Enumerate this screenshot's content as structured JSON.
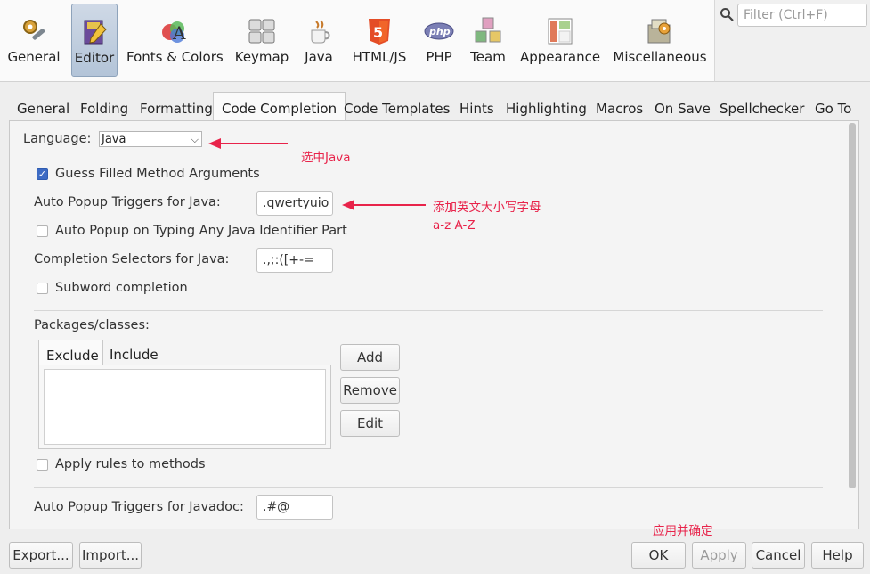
{
  "toolbar": {
    "categories": [
      {
        "label": "General",
        "icon": "gear-wrench-icon"
      },
      {
        "label": "Editor",
        "icon": "editor-book-icon"
      },
      {
        "label": "Fonts & Colors",
        "icon": "fonts-colors-icon"
      },
      {
        "label": "Keymap",
        "icon": "keyboard-icon"
      },
      {
        "label": "Java",
        "icon": "java-cup-icon"
      },
      {
        "label": "HTML/JS",
        "icon": "html5-icon"
      },
      {
        "label": "PHP",
        "icon": "php-icon"
      },
      {
        "label": "Team",
        "icon": "team-cubes-icon"
      },
      {
        "label": "Appearance",
        "icon": "appearance-window-icon"
      },
      {
        "label": "Miscellaneous",
        "icon": "misc-folder-gear-icon"
      }
    ],
    "selected": "Editor",
    "filter_placeholder": "Filter (Ctrl+F)"
  },
  "tabs": [
    "General",
    "Folding",
    "Formatting",
    "Code Completion",
    "Code Templates",
    "Hints",
    "Highlighting",
    "Macros",
    "On Save",
    "Spellchecker",
    "Go To"
  ],
  "active_tab": "Code Completion",
  "form": {
    "language_label": "Language:",
    "language_value": "Java",
    "guess_filled": {
      "label": "Guess Filled Method Arguments",
      "checked": true
    },
    "auto_popup_triggers_label": "Auto Popup Triggers for Java:",
    "auto_popup_triggers_value": ".qwertyuio",
    "auto_popup_typing": {
      "label": "Auto Popup on Typing Any Java Identifier Part",
      "checked": false
    },
    "completion_selectors_label": "Completion Selectors for Java:",
    "completion_selectors_value": ".,;:([+-=",
    "subword": {
      "label": "Subword completion",
      "checked": false
    },
    "packages_label": "Packages/classes:",
    "subtabs": [
      "Exclude",
      "Include"
    ],
    "buttons": {
      "add": "Add",
      "remove": "Remove",
      "edit": "Edit"
    },
    "apply_rules": {
      "label": "Apply rules to methods",
      "checked": false
    },
    "javadoc_triggers_label": "Auto Popup Triggers for Javadoc:",
    "javadoc_triggers_value": ".#@"
  },
  "annotations": {
    "select_java": "选中Java",
    "add_letters_1": "添加英文大小写字母",
    "add_letters_2": "a-z A-Z",
    "apply_confirm": "应用并确定"
  },
  "footer": {
    "export": "Export...",
    "import": "Import...",
    "ok": "OK",
    "apply": "Apply",
    "cancel": "Cancel",
    "help": "Help"
  },
  "colors": {
    "annotation": "#e8234a",
    "selected_category": "#b3c4d8",
    "checkbox_on": "#3d6bc4"
  }
}
